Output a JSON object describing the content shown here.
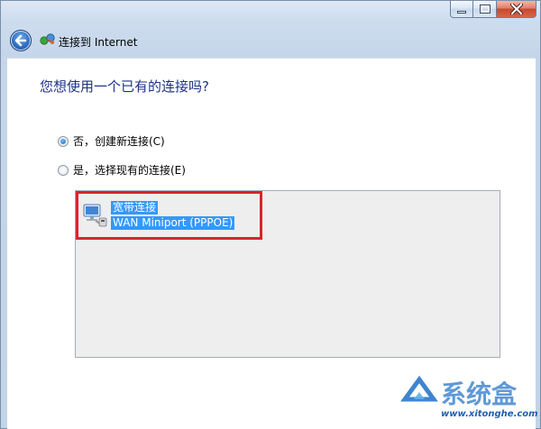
{
  "window": {
    "title": "连接到 Internet",
    "controls": {
      "minimize": "minimize-icon",
      "maximize": "maximize-icon",
      "close": "close-icon"
    }
  },
  "nav": {
    "back_icon": "back-arrow-icon",
    "page_icon": "network-connection-icon"
  },
  "main": {
    "heading": "您想使用一个已有的连接吗?",
    "options": [
      {
        "label": "否，创建新连接(C)",
        "selected": true
      },
      {
        "label": "是，选择现有的连接(E)",
        "selected": false
      }
    ],
    "connections": [
      {
        "name": "宽带连接",
        "device": "WAN Miniport (PPPOE)",
        "icon": "network-computer-icon",
        "selected": true
      }
    ]
  },
  "colors": {
    "heading": "#1e3287",
    "selection": "#3399ff",
    "highlight_border": "#d8252b",
    "list_background": "#eeeeee"
  },
  "watermark": {
    "site": "www.xitonghe.com"
  }
}
